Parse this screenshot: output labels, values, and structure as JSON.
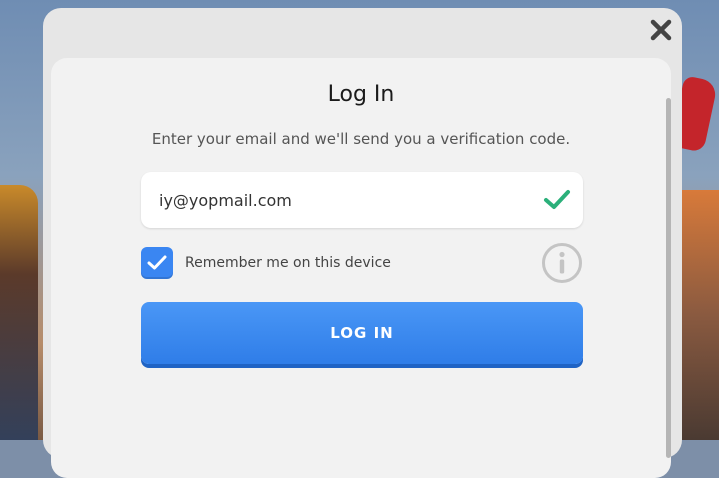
{
  "modal": {
    "title": "Log In",
    "subtitle": "Enter your email and we'll send you a verification code.",
    "email": {
      "value": "iy@yopmail.com",
      "valid": true
    },
    "remember": {
      "label": "Remember me on this device",
      "checked": true
    },
    "login_label": "LOG IN"
  },
  "icons": {
    "close": "close-icon",
    "check": "checkmark-icon",
    "info": "info-icon"
  },
  "colors": {
    "accent": "#3a86f2",
    "valid": "#2bb07a"
  }
}
